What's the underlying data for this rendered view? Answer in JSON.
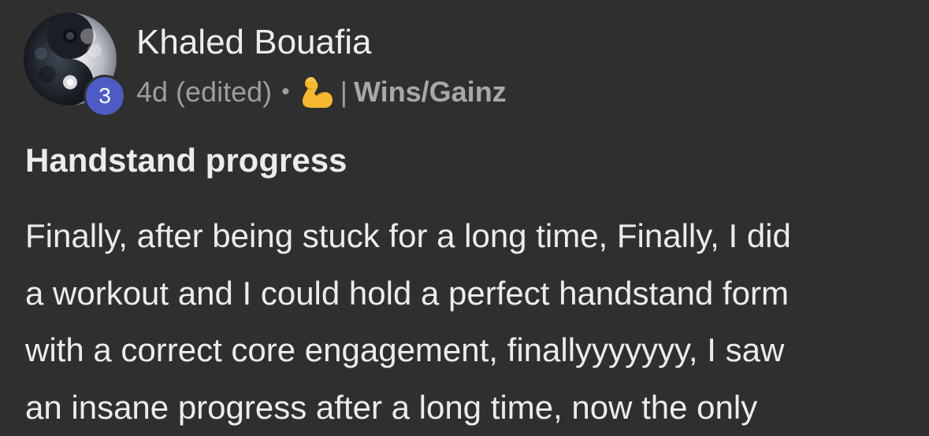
{
  "post": {
    "author": {
      "name": "Khaled Bouafia",
      "level": "3",
      "avatar_icon": "yin-yang-avatar-icon"
    },
    "meta": {
      "time": "4d (edited)",
      "separator_dot": "•",
      "flair_icon": "flexed-biceps-emoji",
      "divider": "|",
      "category": "Wins/Gainz"
    },
    "title": "Handstand progress",
    "body_lines": [
      "Finally, after being stuck for a long time, Finally, I did",
      "a workout and I could hold a perfect handstand form",
      "with a correct core engagement, finallyyyyyyy, I saw",
      "an insane progress after a long time, now the only"
    ]
  },
  "colors": {
    "background": "#2f2f2f",
    "primary_text": "#ececec",
    "secondary_text": "#9d9d9d",
    "level_badge": "#4c5cc4"
  }
}
